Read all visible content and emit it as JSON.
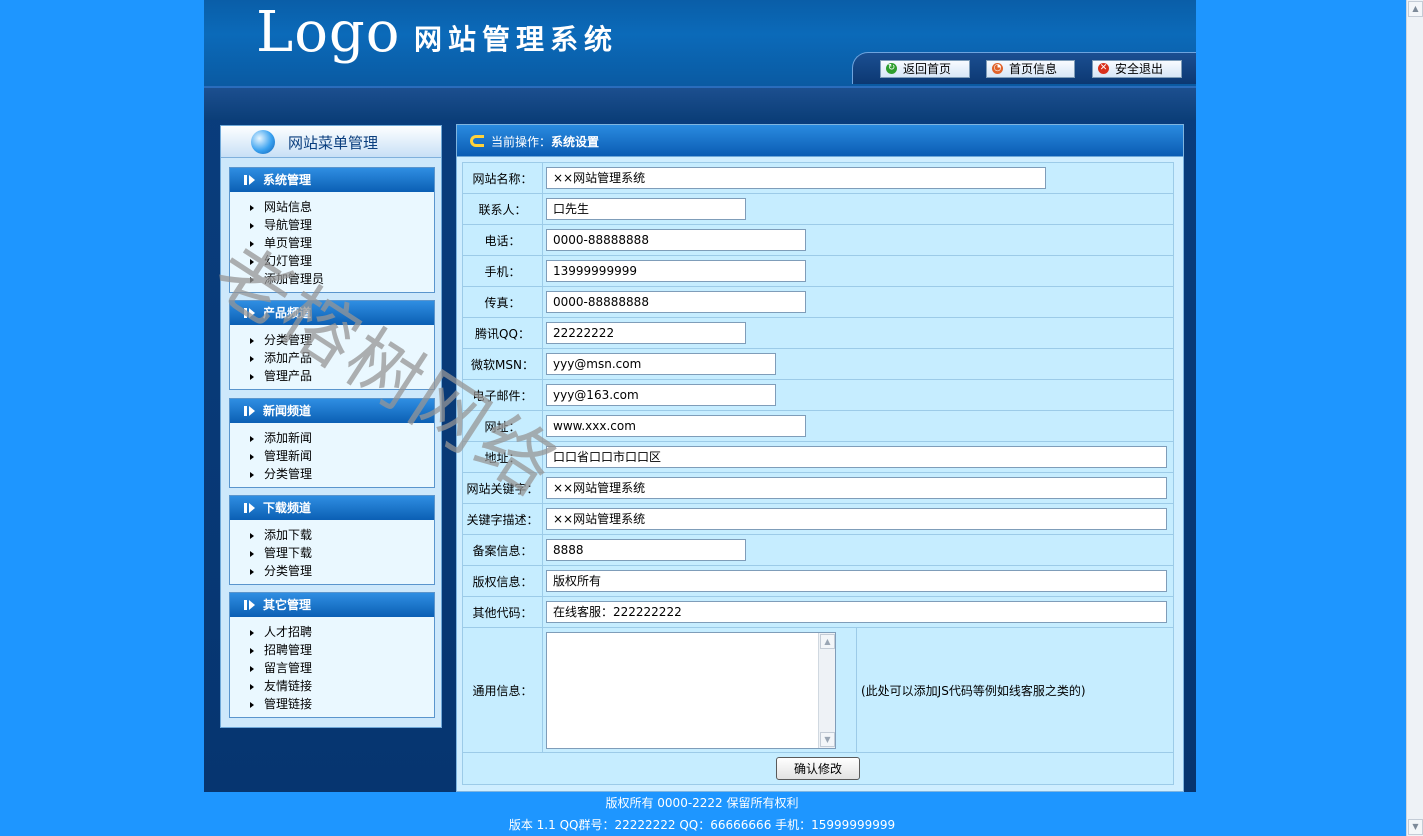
{
  "header": {
    "logo": "Logo",
    "system_name": "网站管理系统",
    "nav": [
      {
        "label": "返回首页",
        "icon": "refresh-icon",
        "color": "#2e9e2e"
      },
      {
        "label": "首页信息",
        "icon": "pie-chart-icon",
        "color": "#e0622a"
      },
      {
        "label": "安全退出",
        "icon": "close-icon",
        "color": "#d9301c"
      }
    ]
  },
  "sidebar": {
    "title": "网站菜单管理",
    "groups": [
      {
        "title": "系统管理",
        "items": [
          "网站信息",
          "导航管理",
          "单页管理",
          "幻灯管理",
          "添加管理员"
        ]
      },
      {
        "title": "产品频道",
        "items": [
          "分类管理",
          "添加产品",
          "管理产品"
        ]
      },
      {
        "title": "新闻频道",
        "items": [
          "添加新闻",
          "管理新闻",
          "分类管理"
        ]
      },
      {
        "title": "下载频道",
        "items": [
          "添加下载",
          "管理下载",
          "分类管理"
        ]
      },
      {
        "title": "其它管理",
        "items": [
          "人才招聘",
          "招聘管理",
          "留言管理",
          "友情链接",
          "管理链接"
        ]
      }
    ]
  },
  "main": {
    "current_prefix": "当前操作：",
    "current_op": "系统设置",
    "fields": [
      {
        "label": "网站名称：",
        "value": "××网站管理系统"
      },
      {
        "label": "联系人：",
        "value": "口先生"
      },
      {
        "label": "电话：",
        "value": "0000-88888888"
      },
      {
        "label": "手机：",
        "value": "13999999999"
      },
      {
        "label": "传真：",
        "value": "0000-88888888"
      },
      {
        "label": "腾讯QQ：",
        "value": "22222222"
      },
      {
        "label": "微软MSN：",
        "value": "yyy@msn.com"
      },
      {
        "label": "电子邮件：",
        "value": "yyy@163.com"
      },
      {
        "label": "网址：",
        "value": "www.xxx.com"
      },
      {
        "label": "地址：",
        "value": "口口省口口市口口区"
      },
      {
        "label": "网站关键字：",
        "value": "××网站管理系统"
      },
      {
        "label": "关键字描述：",
        "value": "××网站管理系统"
      },
      {
        "label": "备案信息：",
        "value": "8888"
      },
      {
        "label": "版权信息：",
        "value": "版权所有"
      },
      {
        "label": "其他代码：",
        "value": "在线客服：222222222"
      }
    ],
    "general_label": "通用信息：",
    "general_value": "",
    "general_hint": "(此处可以添加JS代码等例如线客服之类的)",
    "submit_label": "确认修改"
  },
  "footer": {
    "line1": "版权所有 0000-2222 保留所有权利",
    "line2": "版本 1.1 QQ群号：22222222 QQ：66666666 手机：15999999999"
  },
  "watermark": "老榕树网络"
}
